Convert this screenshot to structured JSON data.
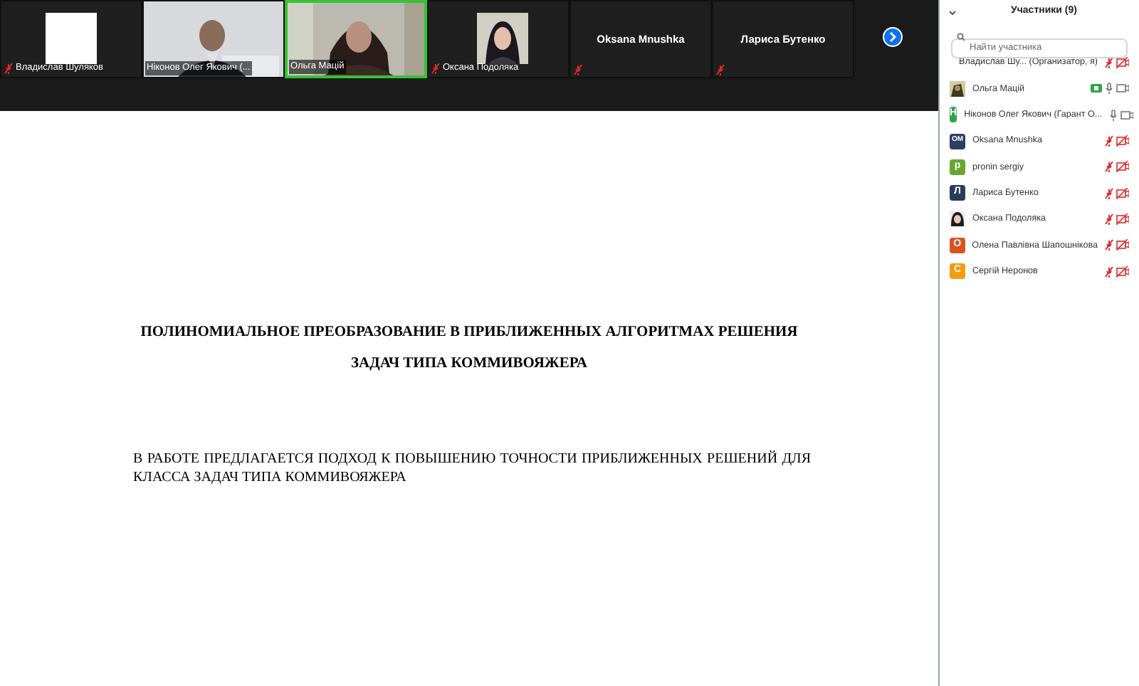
{
  "video_strip": [
    {
      "kind": "blank",
      "name": "Владислав Шуляков",
      "muted": true,
      "speaking": false
    },
    {
      "kind": "picture",
      "name": "Ніконов Олег Якович  (...",
      "muted": false,
      "speaking": false
    },
    {
      "kind": "picture",
      "name": "Ольга Мацій",
      "muted": false,
      "speaking": true
    },
    {
      "name": "Оксана Подоляка",
      "muted": true,
      "speaking": false
    },
    {
      "kind": "name",
      "name": "Oksana Mnushka",
      "muted": true,
      "speaking": false
    },
    {
      "kind": "name",
      "name": "Лариса Бутенко",
      "muted": true,
      "speaking": false
    }
  ],
  "slide": {
    "title": [
      "ПОЛИНОМИАЛЬНОЕ ПРЕОБРАЗОВАНИЕ В ПРИБЛИЖЕННЫХ АЛГОРИТМАХ РЕШЕНИЯ",
      "ЗАДАЧ ТИПА КОММИВОЯЖЕРА"
    ],
    "paragraph": "В РАБОТЕ ПРЕДЛАГАЕТСЯ ПОДХОД К ПОВЫШЕНИЮ ТОЧНОСТИ ПРИБЛИЖЕННЫХ РЕШЕНИЙ ДЛЯ КЛАССА ЗАДАЧ ТИПА КОММИВОЯЖЕРА"
  },
  "participants_panel": {
    "title": "Участники (9)",
    "search": {
      "placeholder": "Найти участника"
    },
    "participants": [
      {
        "kind": "none",
        "name": "Владислав Шу...  (Организатор, я)",
        "mic_muted": true,
        "video_off": true,
        "sharing": false
      },
      {
        "kind": "picture",
        "name": "Ольга Мацій",
        "mic_muted": false,
        "video_off": false,
        "sharing": true
      },
      {
        "kind": "letter",
        "initials": "Н",
        "color": "#2fa44f",
        "name": "Ніконов Олег Якович  (Гарант О...",
        "mic_muted": false,
        "video_off": false,
        "sharing": false
      },
      {
        "kind": "letter",
        "initials": "OM",
        "color": "#2c3e66",
        "name": "Oksana Mnushka",
        "mic_muted": true,
        "video_off": true,
        "sharing": false
      },
      {
        "kind": "letter",
        "initials": "p",
        "color": "#6aa531",
        "name": "pronin sergiy",
        "mic_muted": true,
        "video_off": true,
        "sharing": false
      },
      {
        "kind": "letter",
        "initials": "Л",
        "color": "#2a3b5c",
        "name": "Лариса Бутенко",
        "mic_muted": true,
        "video_off": true,
        "sharing": false
      },
      {
        "name": "Оксана Подоляка",
        "mic_muted": true,
        "video_off": true,
        "sharing": false
      },
      {
        "kind": "letter",
        "initials": "О",
        "color": "#d9531e",
        "name": "Олена Павлівна Шапошнікова",
        "mic_muted": true,
        "video_off": true,
        "sharing": false
      },
      {
        "kind": "letter",
        "initials": "С",
        "color": "#f39c12",
        "name": "Сергій Неронов",
        "mic_muted": true,
        "video_off": true,
        "sharing": false
      }
    ]
  }
}
